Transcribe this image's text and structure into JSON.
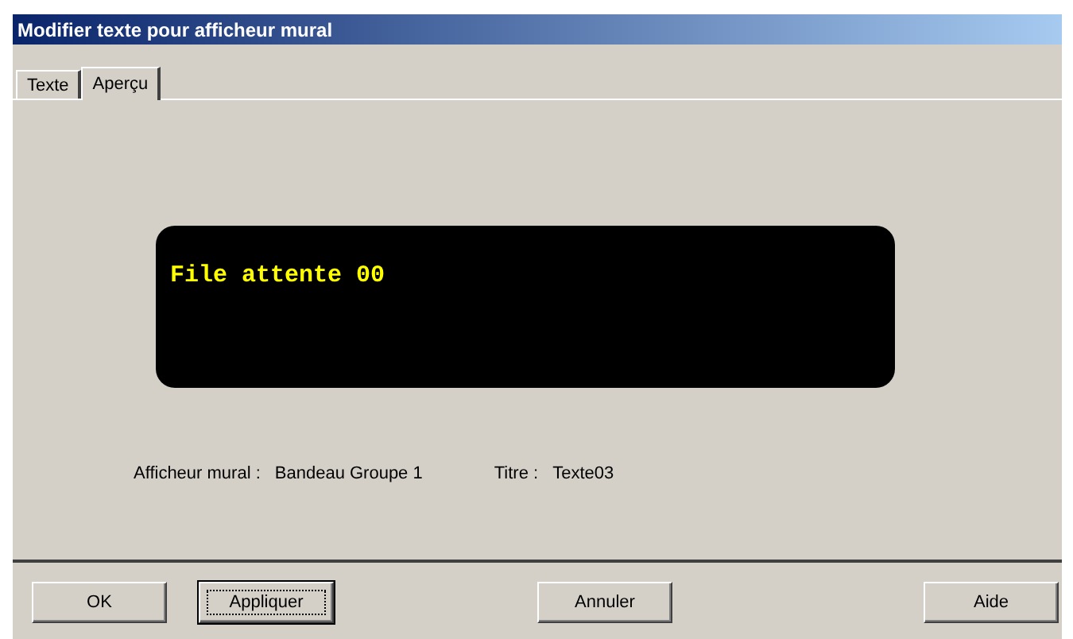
{
  "window": {
    "title": "Modifier texte pour afficheur mural"
  },
  "tabs": [
    {
      "label": "Texte",
      "selected": false
    },
    {
      "label": "Aperçu",
      "selected": true
    }
  ],
  "display": {
    "text": "File attente 00"
  },
  "info": {
    "display_label": "Afficheur mural :",
    "display_value": "Bandeau Groupe 1",
    "title_label": "Titre :",
    "title_value": "Texte03"
  },
  "buttons": [
    {
      "label": "OK",
      "focused": false
    },
    {
      "label": "Appliquer",
      "focused": true
    },
    {
      "label": "Annuler",
      "focused": false
    },
    {
      "label": "Aide",
      "focused": false
    }
  ]
}
